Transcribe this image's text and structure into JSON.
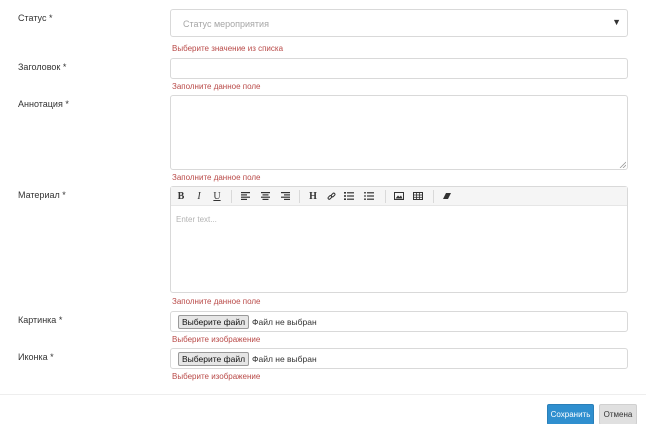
{
  "form": {
    "status": {
      "label": "Статус *",
      "placeholder": "Статус мероприятия",
      "error": "Выберите значение из списка"
    },
    "title": {
      "label": "Заголовок *",
      "value": "",
      "error": "Заполните данное поле"
    },
    "annotation": {
      "label": "Аннотация *",
      "value": "",
      "error": "Заполните данное поле"
    },
    "material": {
      "label": "Материал *",
      "placeholder": "Enter text...",
      "toolbar": [
        "bold-icon",
        "italic-icon",
        "underline-icon",
        "align-left-icon",
        "align-center-icon",
        "align-right-icon",
        "heading-icon",
        "link-icon",
        "ordered-list-icon",
        "unordered-list-icon",
        "image-icon",
        "table-icon",
        "eraser-icon"
      ],
      "toolbar_labels": {
        "bold": "B",
        "italic": "I",
        "underline": "U",
        "heading": "H"
      },
      "error": "Заполните данное поле"
    },
    "image": {
      "label": "Картинка *",
      "button": "Выберите файл",
      "status": "Файл не выбран",
      "error": "Выберите изображение"
    },
    "icon": {
      "label": "Иконка *",
      "button": "Выберите файл",
      "status": "Файл не выбран",
      "error": "Выберите изображение"
    }
  },
  "footer": {
    "save_label": "Сохранить",
    "cancel_label": "Отмена"
  },
  "colors": {
    "error": "#b94a48",
    "primary": "#2f8fcf",
    "border": "#d9d9d9"
  }
}
